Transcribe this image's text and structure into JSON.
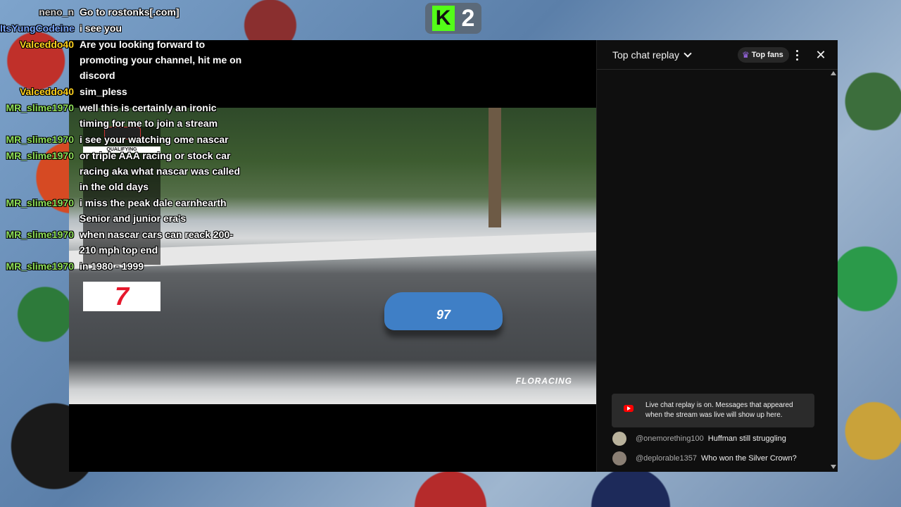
{
  "kick": {
    "logo": "K",
    "count": "2"
  },
  "overlay_chat": [
    {
      "name": "neno_n",
      "color": "#d0d0d0",
      "text": "Go to rostonks[.com]"
    },
    {
      "name": "ItsYungCodeine",
      "color": "#7aa7ff",
      "text": "i see you"
    },
    {
      "name": "Valceddo40",
      "color": "#ffd21f",
      "text": "Are you looking forward to promoting your channel, hit me on discord"
    },
    {
      "name": "Valceddo40",
      "color": "#ffd21f",
      "text": "sim_pless"
    },
    {
      "name": "MR_slime1970",
      "color": "#8fe05a",
      "text": "well this is certainly an ironic timing for me to join a stream"
    },
    {
      "name": "MR_slime1970",
      "color": "#8fe05a",
      "text": "i see your watching ome nascar"
    },
    {
      "name": "MR_slime1970",
      "color": "#8fe05a",
      "text": "or triple AAA racing or stock car racing aka what nascar was called in the old days"
    },
    {
      "name": "MR_slime1970",
      "color": "#8fe05a",
      "text": "i miss the peak dale earnhearth Senior and junior era's"
    },
    {
      "name": "MR_slime1970",
      "color": "#8fe05a",
      "text": "when nascar cars can reack 200-210 mph top end"
    },
    {
      "name": "MR_slime1970",
      "color": "#8fe05a",
      "text": "in 1980 - 1999"
    }
  ],
  "video": {
    "board_title": "QUALIFYING",
    "car_number": "97",
    "watermark": "FLORACING",
    "fs_logo": "7"
  },
  "chat_panel": {
    "title": "Top chat replay",
    "top_fans_label": "Top fans",
    "close_glyph": "✕",
    "notice": "Live chat replay is on. Messages that appeared when the stream was live will show up here.",
    "messages": [
      {
        "author": "@onemorething100",
        "text": "Huffman still struggling"
      },
      {
        "author": "@deplorable1357",
        "text": "Who won the Silver Crown?"
      }
    ]
  }
}
